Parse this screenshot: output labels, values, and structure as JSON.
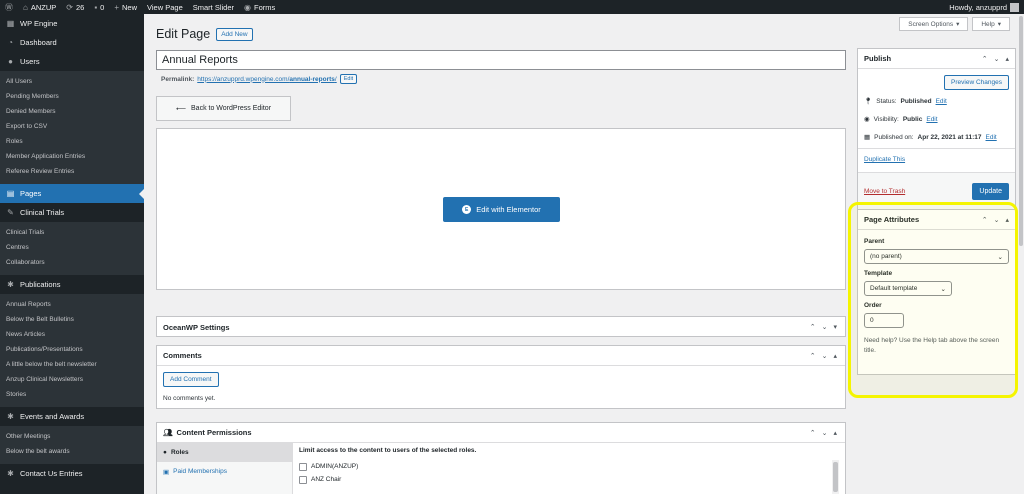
{
  "admin_bar": {
    "site_name": "ANZUP",
    "updates_count": "26",
    "comments_count": "0",
    "new_label": "New",
    "view_page": "View Page",
    "smart_slider": "Smart Slider",
    "forms": "Forms",
    "howdy": "Howdy, anzupprd"
  },
  "sidebar": {
    "wp_engine": "WP Engine",
    "dashboard": "Dashboard",
    "users": {
      "label": "Users",
      "items": [
        "All Users",
        "Pending Members",
        "Denied Members",
        "Export to CSV",
        "Roles",
        "Member Application Entries",
        "Referee Review Entries"
      ]
    },
    "pages": "Pages",
    "clinical_trials": {
      "label": "Clinical Trials",
      "items": [
        "Clinical Trials",
        "Centres",
        "Collaborators"
      ]
    },
    "publications": {
      "label": "Publications",
      "items": [
        "Annual Reports",
        "Below the Belt Bulletins",
        "News Articles",
        "Publications/Presentations",
        "A little below the belt newsletter",
        "Anzup Clinical Newsletters",
        "Stories"
      ]
    },
    "events": {
      "label": "Events and Awards",
      "items": [
        "Other Meetings",
        "Below the belt awards"
      ]
    },
    "contact_us": "Contact Us Entries"
  },
  "screen_options": "Screen Options",
  "help": "Help",
  "page": {
    "heading": "Edit Page",
    "add_new": "Add New",
    "title_value": "Annual Reports",
    "permalink_label": "Permalink:",
    "permalink_base": "https://anzupprd.wpengine.com/",
    "permalink_slug": "annual-reports",
    "permalink_end": "/",
    "permalink_edit": "Edit",
    "back_button": "Back to WordPress Editor",
    "elementor_button": "Edit with Elementor",
    "elementor_logo": "E"
  },
  "oceanwp": {
    "title": "OceanWP Settings"
  },
  "comments": {
    "title": "Comments",
    "add_button": "Add Comment",
    "empty": "No comments yet."
  },
  "permissions": {
    "title": "Content Permissions",
    "tabs": [
      "Roles",
      "Paid Memberships"
    ],
    "heading": "Limit access to the content to users of the selected roles.",
    "roles": [
      "ADMIN(ANZUP)",
      "ANZ Chair"
    ]
  },
  "publish": {
    "title": "Publish",
    "preview": "Preview Changes",
    "status_label": "Status:",
    "status_value": "Published",
    "visibility_label": "Visibility:",
    "visibility_value": "Public",
    "published_label": "Published on:",
    "published_value": "Apr 22, 2021 at 11:17",
    "edit": "Edit",
    "duplicate": "Duplicate This",
    "trash": "Move to Trash",
    "update": "Update"
  },
  "attributes": {
    "title": "Page Attributes",
    "parent_label": "Parent",
    "parent_value": "(no parent)",
    "template_label": "Template",
    "template_value": "Default template",
    "order_label": "Order",
    "order_value": "0",
    "help_text": "Need help? Use the Help tab above the screen title."
  },
  "colors": {
    "accent": "#2271b1",
    "admin_dark": "#1d2327",
    "highlight": "#f5f500",
    "trash": "#b32d2e"
  }
}
